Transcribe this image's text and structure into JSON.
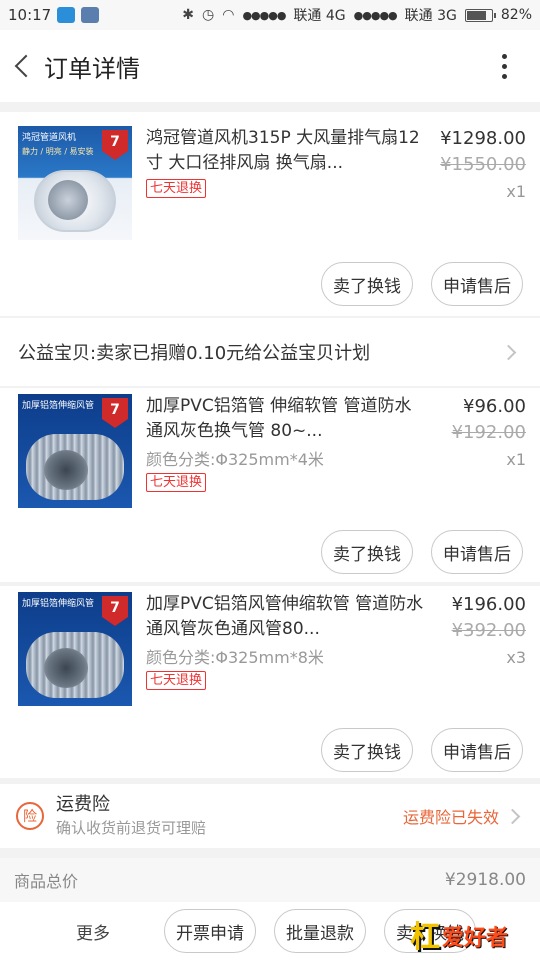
{
  "status_bar": {
    "time": "10:17",
    "carrier1": "联通 4G",
    "carrier2": "联通 3G",
    "battery": "82%",
    "battery_level": 0.82
  },
  "header": {
    "title": "订单详情"
  },
  "items": [
    {
      "name": "鸿冠管道风机315P 大风量排气扇12寸 大口径排风扇 换气扇...",
      "spec": "",
      "tag": "七天退换",
      "price": "¥1298.00",
      "orig_price": "¥1550.00",
      "qty": "x1",
      "thumb_caption": "鸿冠管道风机",
      "thumb_caption2": "静力 / 明亮 / 易安装",
      "buttons": [
        "卖了换钱",
        "申请售后"
      ]
    },
    {
      "name": "加厚PVC铝箔管 伸缩软管 管道防水通风灰色换气管 80~...",
      "spec": "颜色分类:Φ325mm*4米",
      "tag": "七天退换",
      "price": "¥96.00",
      "orig_price": "¥192.00",
      "qty": "x1",
      "thumb_caption": "加厚铝箔伸缩风管",
      "thumb_caption2": "",
      "buttons": [
        "卖了换钱",
        "申请售后"
      ]
    },
    {
      "name": "加厚PVC铝箔风管伸缩软管 管道防水通风管灰色通风管80...",
      "spec": "颜色分类:Φ325mm*8米",
      "tag": "七天退换",
      "price": "¥196.00",
      "orig_price": "¥392.00",
      "qty": "x3",
      "thumb_caption": "加厚铝箔伸缩风管",
      "thumb_caption2": "",
      "buttons": [
        "卖了换钱",
        "申请售后"
      ]
    }
  ],
  "charity": {
    "text": "公益宝贝:卖家已捐赠0.10元给公益宝贝计划"
  },
  "insurance": {
    "icon": "险",
    "title": "运费险",
    "subtitle": "确认收货前退货可理赔",
    "status": "运费险已失效"
  },
  "total": {
    "label": "商品总价",
    "value": "¥2918.00"
  },
  "bottom_bar": {
    "more": "更多",
    "buttons": [
      "开票申请",
      "批量退款",
      "卖了换钱"
    ]
  },
  "watermark": {
    "text_a": "杠",
    "text_b": "爱好者"
  }
}
